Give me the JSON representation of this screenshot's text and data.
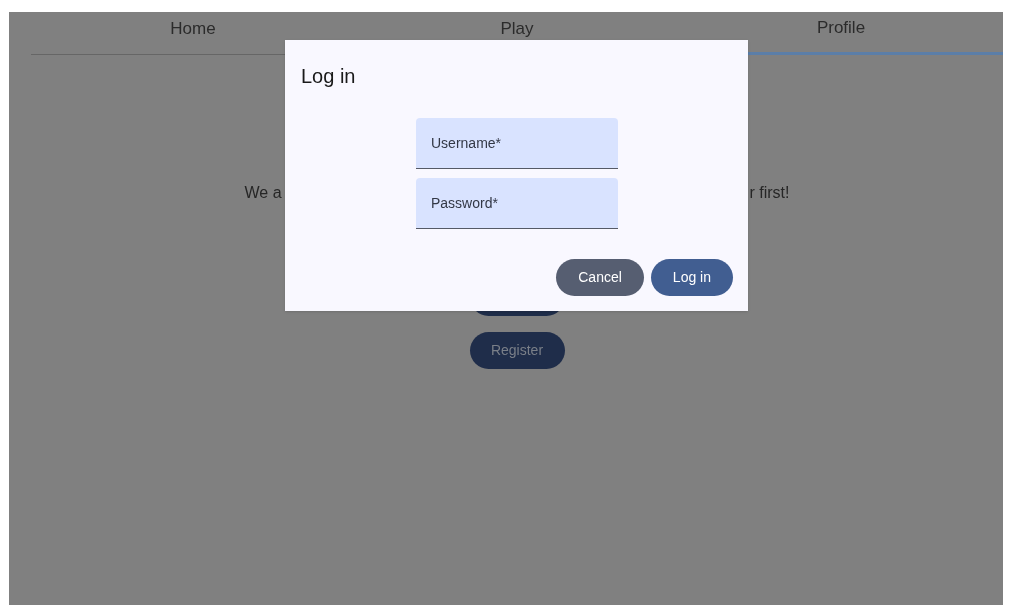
{
  "tabs": [
    {
      "label": "Home",
      "selected": false
    },
    {
      "label": "Play",
      "selected": false
    },
    {
      "label": "Profile",
      "selected": true
    }
  ],
  "message_fragments": [
    "We a",
    "r first!"
  ],
  "register_button": "Register",
  "dialog": {
    "title": "Log in",
    "fields": [
      {
        "placeholder": "Username*"
      },
      {
        "placeholder": "Password*"
      }
    ],
    "buttons": [
      {
        "label": "Cancel",
        "kind": "secondary"
      },
      {
        "label": "Log in",
        "kind": "primary"
      }
    ]
  }
}
